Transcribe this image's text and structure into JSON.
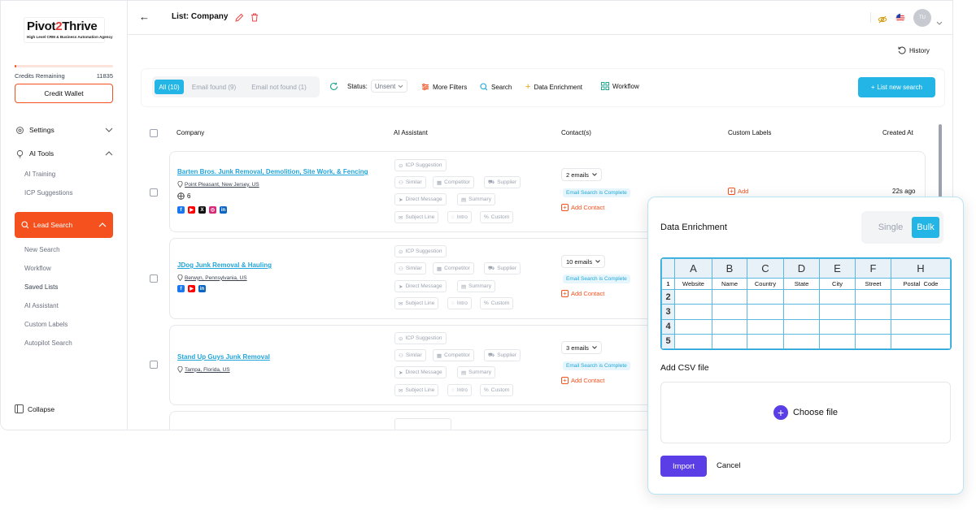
{
  "brand": {
    "name_a": "Pivot",
    "name_b": "2",
    "name_c": "Thrive",
    "tagline": "High Level CRM & Business Automation Agency"
  },
  "sidebar": {
    "credits_label": "Credits Remaining",
    "credits_value": "11835",
    "credit_wallet": "Credit Wallet",
    "settings": "Settings",
    "ai_tools": "AI Tools",
    "ai_tools_items": [
      "AI Training",
      "ICP Suggestions"
    ],
    "lead_search": "Lead Search",
    "lead_items": [
      "New Search",
      "Workflow",
      "Saved Lists",
      "AI Assistant",
      "Custom Labels",
      "Autopilot Search"
    ],
    "collapse": "Collapse"
  },
  "header": {
    "title": "List: Company",
    "avatar": "TU",
    "history": "History"
  },
  "filters": {
    "tabs": [
      "All (10)",
      "Email found (9)",
      "Email not found (1)"
    ],
    "status_label": "Status:",
    "status_value": "Unsent",
    "more_filters": "More Filters",
    "search": "Search",
    "enrichment": "Data Enrichment",
    "workflow": "Workflow",
    "list_new": "List new search"
  },
  "table": {
    "headers": {
      "company": "Company",
      "ai": "AI Assistant",
      "contacts": "Contact(s)",
      "labels": "Custom Labels",
      "created": "Created At"
    },
    "chips": {
      "icp": "ICP Suggestion",
      "similar": "Similar",
      "competitor": "Competitor",
      "supplier": "Supplier",
      "direct": "Direct Message",
      "summary": "Summary",
      "subject": "Subject Line",
      "intro": "Intro",
      "custom": "Custom"
    },
    "complete_text": "Email Search is Complete",
    "add_contact": "Add Contact",
    "add_label": "Add",
    "rows": [
      {
        "name": "Barten Bros. Junk Removal, Demolition, Site Work, & Fencing",
        "location": "Point Pleasant, New Jersey, US",
        "employees": "6",
        "emails": "2 emails",
        "created": "22s ago"
      },
      {
        "name": "JDog Junk Removal & Hauling",
        "location": "Berwyn, Pennsylvania, US",
        "emails": "10 emails"
      },
      {
        "name": "Stand Up Guys Junk Removal",
        "location": "Tampa, Florida, US",
        "emails": "3 emails"
      }
    ]
  },
  "modal": {
    "title": "Data Enrichment",
    "single": "Single",
    "bulk": "Bulk",
    "columns": [
      "A",
      "B",
      "C",
      "D",
      "E",
      "F",
      "H"
    ],
    "fields": [
      "Website",
      "Name",
      "Country",
      "State",
      "City",
      "Street",
      "Postal  Code"
    ],
    "row_numbers": [
      "1",
      "2",
      "3",
      "4",
      "5"
    ],
    "csv_label": "Add CSV file",
    "choose_file": "Choose file",
    "import": "Import",
    "cancel": "Cancel"
  },
  "colors": {
    "accent_orange": "#f4511e",
    "accent_blue": "#22b5e5",
    "accent_purple": "#5b3ee6"
  }
}
